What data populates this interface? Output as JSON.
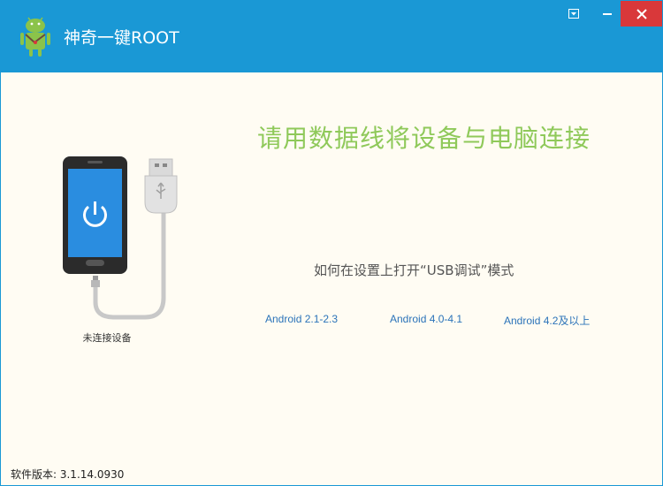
{
  "window": {
    "title": "神奇一键ROOT",
    "controls": {
      "menu_icon": "dropdown-icon",
      "minimize_icon": "minimize-icon",
      "close_icon": "close-icon"
    }
  },
  "main": {
    "headline": "请用数据线将设备与电脑连接",
    "instruction": "如何在设置上打开“USB调试”模式",
    "links": [
      {
        "label": "Android 2.1-2.3"
      },
      {
        "label": "Android 4.0-4.1"
      },
      {
        "label": "Android 4.2及以上"
      }
    ],
    "device_status": "未连接设备"
  },
  "footer": {
    "version": "软件版本:  3.1.14.0930"
  },
  "colors": {
    "titlebar": "#1a98d5",
    "background": "#fffcf3",
    "headline": "#8fc95a",
    "link": "#2b73b9",
    "close": "#d9383a",
    "phone_screen": "#2a8de0"
  }
}
